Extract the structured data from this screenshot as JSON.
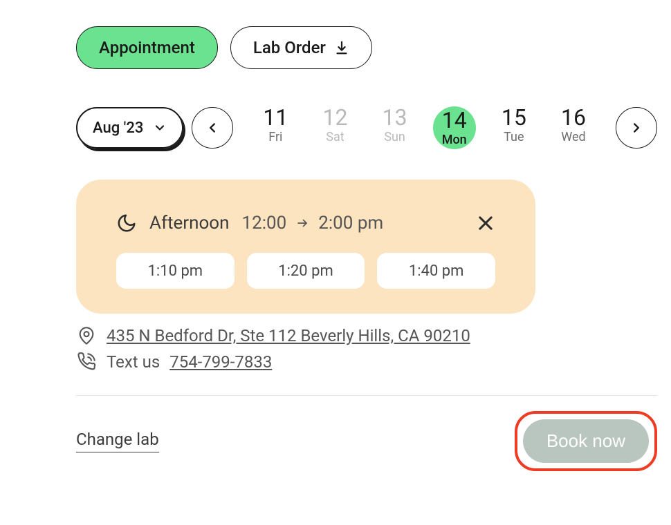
{
  "tabs": {
    "appointment": "Appointment",
    "lab_order": "Lab Order"
  },
  "month_label": "Aug '23",
  "days": [
    {
      "num": "11",
      "name": "Fri"
    },
    {
      "num": "12",
      "name": "Sat"
    },
    {
      "num": "13",
      "name": "Sun"
    },
    {
      "num": "14",
      "name": "Mon"
    },
    {
      "num": "15",
      "name": "Tue"
    },
    {
      "num": "16",
      "name": "Wed"
    }
  ],
  "time": {
    "period": "Afternoon",
    "start": "12:00",
    "end": "2:00 pm",
    "slots": [
      "1:10 pm",
      "1:20 pm",
      "1:40 pm"
    ]
  },
  "address": "435 N Bedford Dr, Ste 112 Beverly Hills, CA 90210",
  "text_us_label": "Text us",
  "phone": "754-799-7833",
  "change_lab_label": "Change lab",
  "book_label": "Book now"
}
